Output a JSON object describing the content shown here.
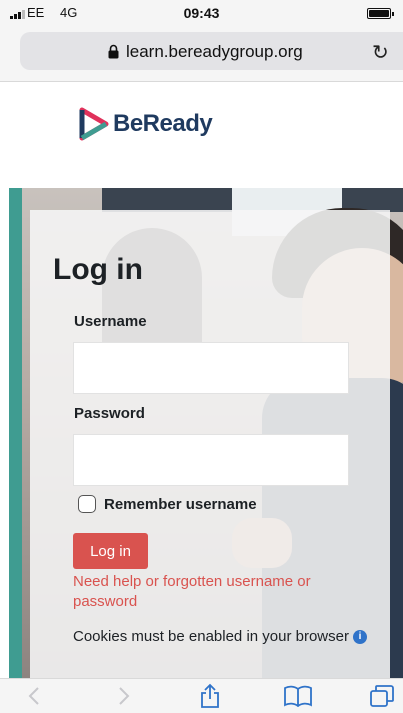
{
  "status_bar": {
    "carrier": "EE",
    "network": "4G",
    "time": "09:43"
  },
  "browser": {
    "url": "learn.bereadygroup.org",
    "reload_icon": "reload-icon",
    "lock_icon": "lock-icon"
  },
  "logo": {
    "text": "BeReady",
    "colors": {
      "primary": "#1f3a5f",
      "accent": "#e0315b",
      "accent2": "#3f9c91"
    }
  },
  "login": {
    "title": "Log in",
    "username_label": "Username",
    "username_value": "",
    "password_label": "Password",
    "password_value": "",
    "remember_label": "Remember username",
    "remember_checked": false,
    "button_label": "Log in",
    "help_link": "Need help or forgotten username or password",
    "cookies_text": "Cookies must be enabled in your browser",
    "info_icon": "info-icon",
    "colors": {
      "button": "#d9534f",
      "link": "#d9534f",
      "teal_bar": "#3f9c91"
    }
  },
  "toolbar": {
    "items": [
      "back-icon",
      "forward-icon",
      "share-icon",
      "bookmarks-icon",
      "tabs-icon"
    ]
  }
}
